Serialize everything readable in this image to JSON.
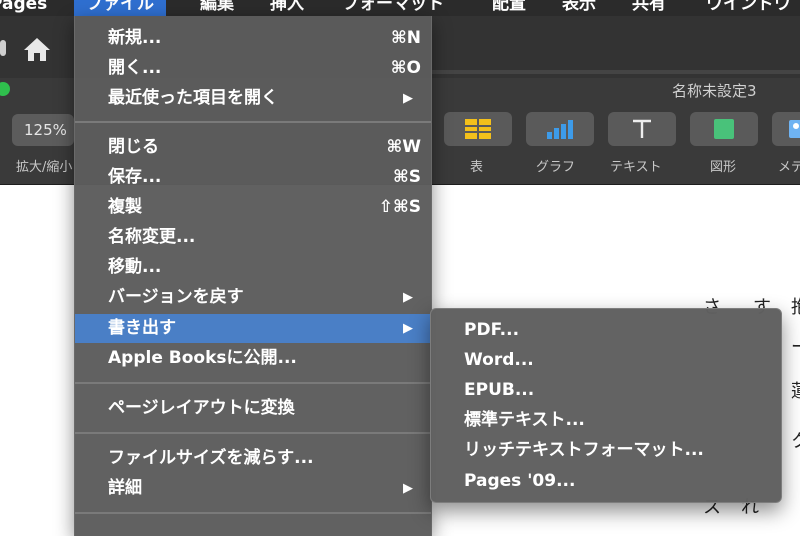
{
  "menubar": {
    "items": [
      {
        "label": "Pages"
      },
      {
        "label": "ファイル"
      },
      {
        "label": "編集"
      },
      {
        "label": "挿入"
      },
      {
        "label": "フォーマット"
      },
      {
        "label": "配置"
      },
      {
        "label": "表示"
      },
      {
        "label": "共有"
      },
      {
        "label": "ウインドウ"
      }
    ],
    "active_index": 1,
    "active_color": "#2f6fd0"
  },
  "window": {
    "document_title": "名称未設定3",
    "zoom_value": "125%",
    "zoom_label": "拡大/縮小",
    "tools": [
      {
        "label": "表",
        "icon": "table-icon"
      },
      {
        "label": "グラフ",
        "icon": "chart-icon"
      },
      {
        "label": "テキスト",
        "icon": "text-icon"
      },
      {
        "label": "図形",
        "icon": "shape-icon"
      },
      {
        "label": "メディア",
        "icon": "media-icon"
      }
    ]
  },
  "file_menu": {
    "items": [
      {
        "label": "新規...",
        "shortcut": "⌘N"
      },
      {
        "label": "開く...",
        "shortcut": "⌘O"
      },
      {
        "label": "最近使った項目を開く",
        "submenu": true
      },
      {
        "label": "閉じる",
        "shortcut": "⌘W"
      },
      {
        "label": "保存...",
        "shortcut": "⌘S"
      },
      {
        "label": "複製",
        "shortcut": "⇧⌘S"
      },
      {
        "label": "名称変更..."
      },
      {
        "label": "移動..."
      },
      {
        "label": "バージョンを戻す",
        "submenu": true
      },
      {
        "label": "書き出す",
        "submenu": true,
        "highlighted": true
      },
      {
        "label": "Apple Booksに公開..."
      },
      {
        "label": "ページレイアウトに変換"
      },
      {
        "label": "ファイルサイズを減らす..."
      },
      {
        "label": "詳細",
        "submenu": true
      }
    ],
    "highlight_color": "#4a7fc6"
  },
  "export_submenu": {
    "items": [
      {
        "label": "PDF..."
      },
      {
        "label": "Word..."
      },
      {
        "label": "EPUB..."
      },
      {
        "label": "標準テキスト..."
      },
      {
        "label": "リッチテキストフォーマット..."
      },
      {
        "label": "Pages '09..."
      }
    ]
  },
  "document": {
    "vertical_text_columns": [
      "さ",
      "す",
      "す",
      "抱",
      "ー",
      "蓮",
      "ク",
      "れ",
      "ス"
    ]
  },
  "submenu_arrow": "▶"
}
